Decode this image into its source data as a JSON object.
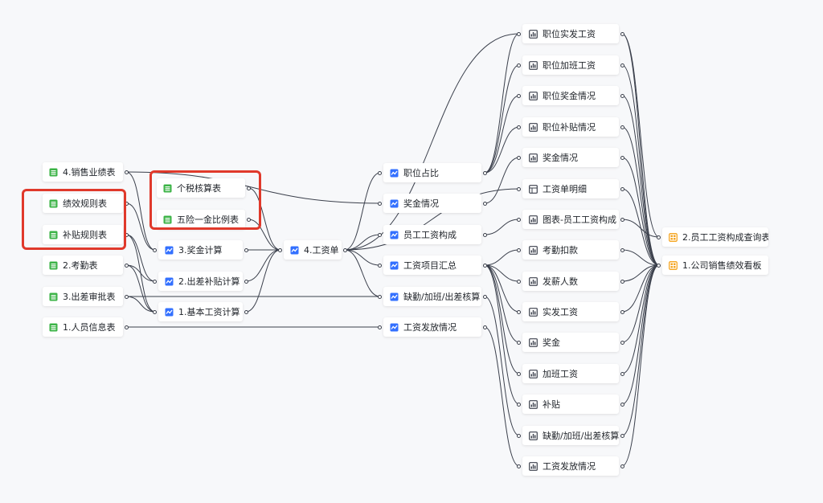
{
  "colors": {
    "sheet": "#3bb346",
    "compute": "#3370ff",
    "chart": "#3a3f4b",
    "dashboard": "#f5a623",
    "edge": "#3a3f4b",
    "highlight": "#e0392b"
  },
  "nodes": {
    "sales_sheet": {
      "label": "4.销售业绩表",
      "kind": "sheet"
    },
    "perf_rules": {
      "label": "绩效规则表",
      "kind": "sheet"
    },
    "subsidy_rules": {
      "label": "补贴规则表",
      "kind": "sheet"
    },
    "attendance": {
      "label": "2.考勤表",
      "kind": "sheet"
    },
    "travel_approval": {
      "label": "3.出差审批表",
      "kind": "sheet"
    },
    "staff_info": {
      "label": "1.人员信息表",
      "kind": "sheet"
    },
    "tax_sheet": {
      "label": "个税核算表",
      "kind": "sheet"
    },
    "insurance_sheet": {
      "label": "五险一金比例表",
      "kind": "sheet"
    },
    "bonus_calc": {
      "label": "3.奖金计算",
      "kind": "compute"
    },
    "travel_calc": {
      "label": "2.出差补贴计算",
      "kind": "compute"
    },
    "base_calc": {
      "label": "1.基本工资计算",
      "kind": "compute"
    },
    "payroll": {
      "label": "4.工资单",
      "kind": "compute"
    },
    "pos_ratio": {
      "label": "职位占比",
      "kind": "compute"
    },
    "bonus_status": {
      "label": "奖金情况",
      "kind": "compute"
    },
    "salary_compose": {
      "label": "员工工资构成",
      "kind": "compute"
    },
    "salary_summary": {
      "label": "工资项目汇总",
      "kind": "compute"
    },
    "absence_calc": {
      "label": "缺勤/加班/出差核算",
      "kind": "compute"
    },
    "pay_status": {
      "label": "工资发放情况",
      "kind": "compute"
    },
    "c_pos_actual": {
      "label": "职位实发工资",
      "kind": "chart"
    },
    "c_pos_overtime": {
      "label": "职位加班工资",
      "kind": "chart"
    },
    "c_pos_bonus": {
      "label": "职位奖金情况",
      "kind": "chart"
    },
    "c_pos_subsidy": {
      "label": "职位补贴情况",
      "kind": "chart"
    },
    "c_bonus": {
      "label": "奖金情况",
      "kind": "chart"
    },
    "c_payroll_detail": {
      "label": "工资单明细",
      "kind": "table"
    },
    "c_chart_compose": {
      "label": "图表-员工工资构成",
      "kind": "chart"
    },
    "c_deduct": {
      "label": "考勤扣款",
      "kind": "chart"
    },
    "c_headcount": {
      "label": "发薪人数",
      "kind": "chart"
    },
    "c_actual": {
      "label": "实发工资",
      "kind": "chart"
    },
    "c_bonus2": {
      "label": "奖金",
      "kind": "chart"
    },
    "c_overtime": {
      "label": "加班工资",
      "kind": "chart"
    },
    "c_subsidy": {
      "label": "补贴",
      "kind": "chart"
    },
    "c_absence": {
      "label": "缺勤/加班/出差核算",
      "kind": "chart"
    },
    "c_pay_status": {
      "label": "工资发放情况",
      "kind": "chart"
    },
    "d_query": {
      "label": "2.员工工资构成查询表",
      "kind": "dashboard"
    },
    "d_board": {
      "label": "1.公司销售绩效看板",
      "kind": "dashboard"
    }
  },
  "edges": [
    [
      "sales_sheet",
      "bonus_calc"
    ],
    [
      "sales_sheet",
      "bonus_status"
    ],
    [
      "perf_rules",
      "bonus_calc"
    ],
    [
      "subsidy_rules",
      "travel_calc"
    ],
    [
      "subsidy_rules",
      "base_calc"
    ],
    [
      "attendance",
      "travel_calc"
    ],
    [
      "attendance",
      "base_calc"
    ],
    [
      "travel_approval",
      "base_calc"
    ],
    [
      "travel_approval",
      "absence_calc"
    ],
    [
      "staff_info",
      "pay_status"
    ],
    [
      "tax_sheet",
      "payroll"
    ],
    [
      "insurance_sheet",
      "payroll"
    ],
    [
      "bonus_calc",
      "payroll"
    ],
    [
      "travel_calc",
      "payroll"
    ],
    [
      "base_calc",
      "payroll"
    ],
    [
      "payroll",
      "pos_ratio"
    ],
    [
      "payroll",
      "salary_compose"
    ],
    [
      "payroll",
      "salary_summary"
    ],
    [
      "payroll",
      "absence_calc"
    ],
    [
      "payroll",
      "c_pos_actual"
    ],
    [
      "pos_ratio",
      "c_pos_actual"
    ],
    [
      "pos_ratio",
      "c_pos_overtime"
    ],
    [
      "pos_ratio",
      "c_pos_bonus"
    ],
    [
      "pos_ratio",
      "c_pos_subsidy"
    ],
    [
      "bonus_status",
      "c_bonus"
    ],
    [
      "payroll",
      "c_payroll_detail"
    ],
    [
      "salary_compose",
      "c_chart_compose"
    ],
    [
      "salary_summary",
      "c_deduct"
    ],
    [
      "salary_summary",
      "c_headcount"
    ],
    [
      "salary_summary",
      "c_actual"
    ],
    [
      "salary_summary",
      "c_bonus2"
    ],
    [
      "salary_summary",
      "c_overtime"
    ],
    [
      "salary_summary",
      "c_subsidy"
    ],
    [
      "absence_calc",
      "c_absence"
    ],
    [
      "pay_status",
      "c_pay_status"
    ],
    [
      "c_pos_actual",
      "d_board"
    ],
    [
      "c_pos_overtime",
      "d_board"
    ],
    [
      "c_pos_bonus",
      "d_board"
    ],
    [
      "c_pos_subsidy",
      "d_board"
    ],
    [
      "c_bonus",
      "d_board"
    ],
    [
      "c_payroll_detail",
      "d_board"
    ],
    [
      "c_chart_compose",
      "d_query"
    ],
    [
      "c_deduct",
      "d_board"
    ],
    [
      "c_headcount",
      "d_board"
    ],
    [
      "c_actual",
      "d_board"
    ],
    [
      "c_bonus2",
      "d_board"
    ],
    [
      "c_overtime",
      "d_board"
    ],
    [
      "c_subsidy",
      "d_board"
    ],
    [
      "c_absence",
      "d_board"
    ],
    [
      "c_pay_status",
      "d_board"
    ],
    [
      "c_pos_actual",
      "d_query"
    ]
  ]
}
